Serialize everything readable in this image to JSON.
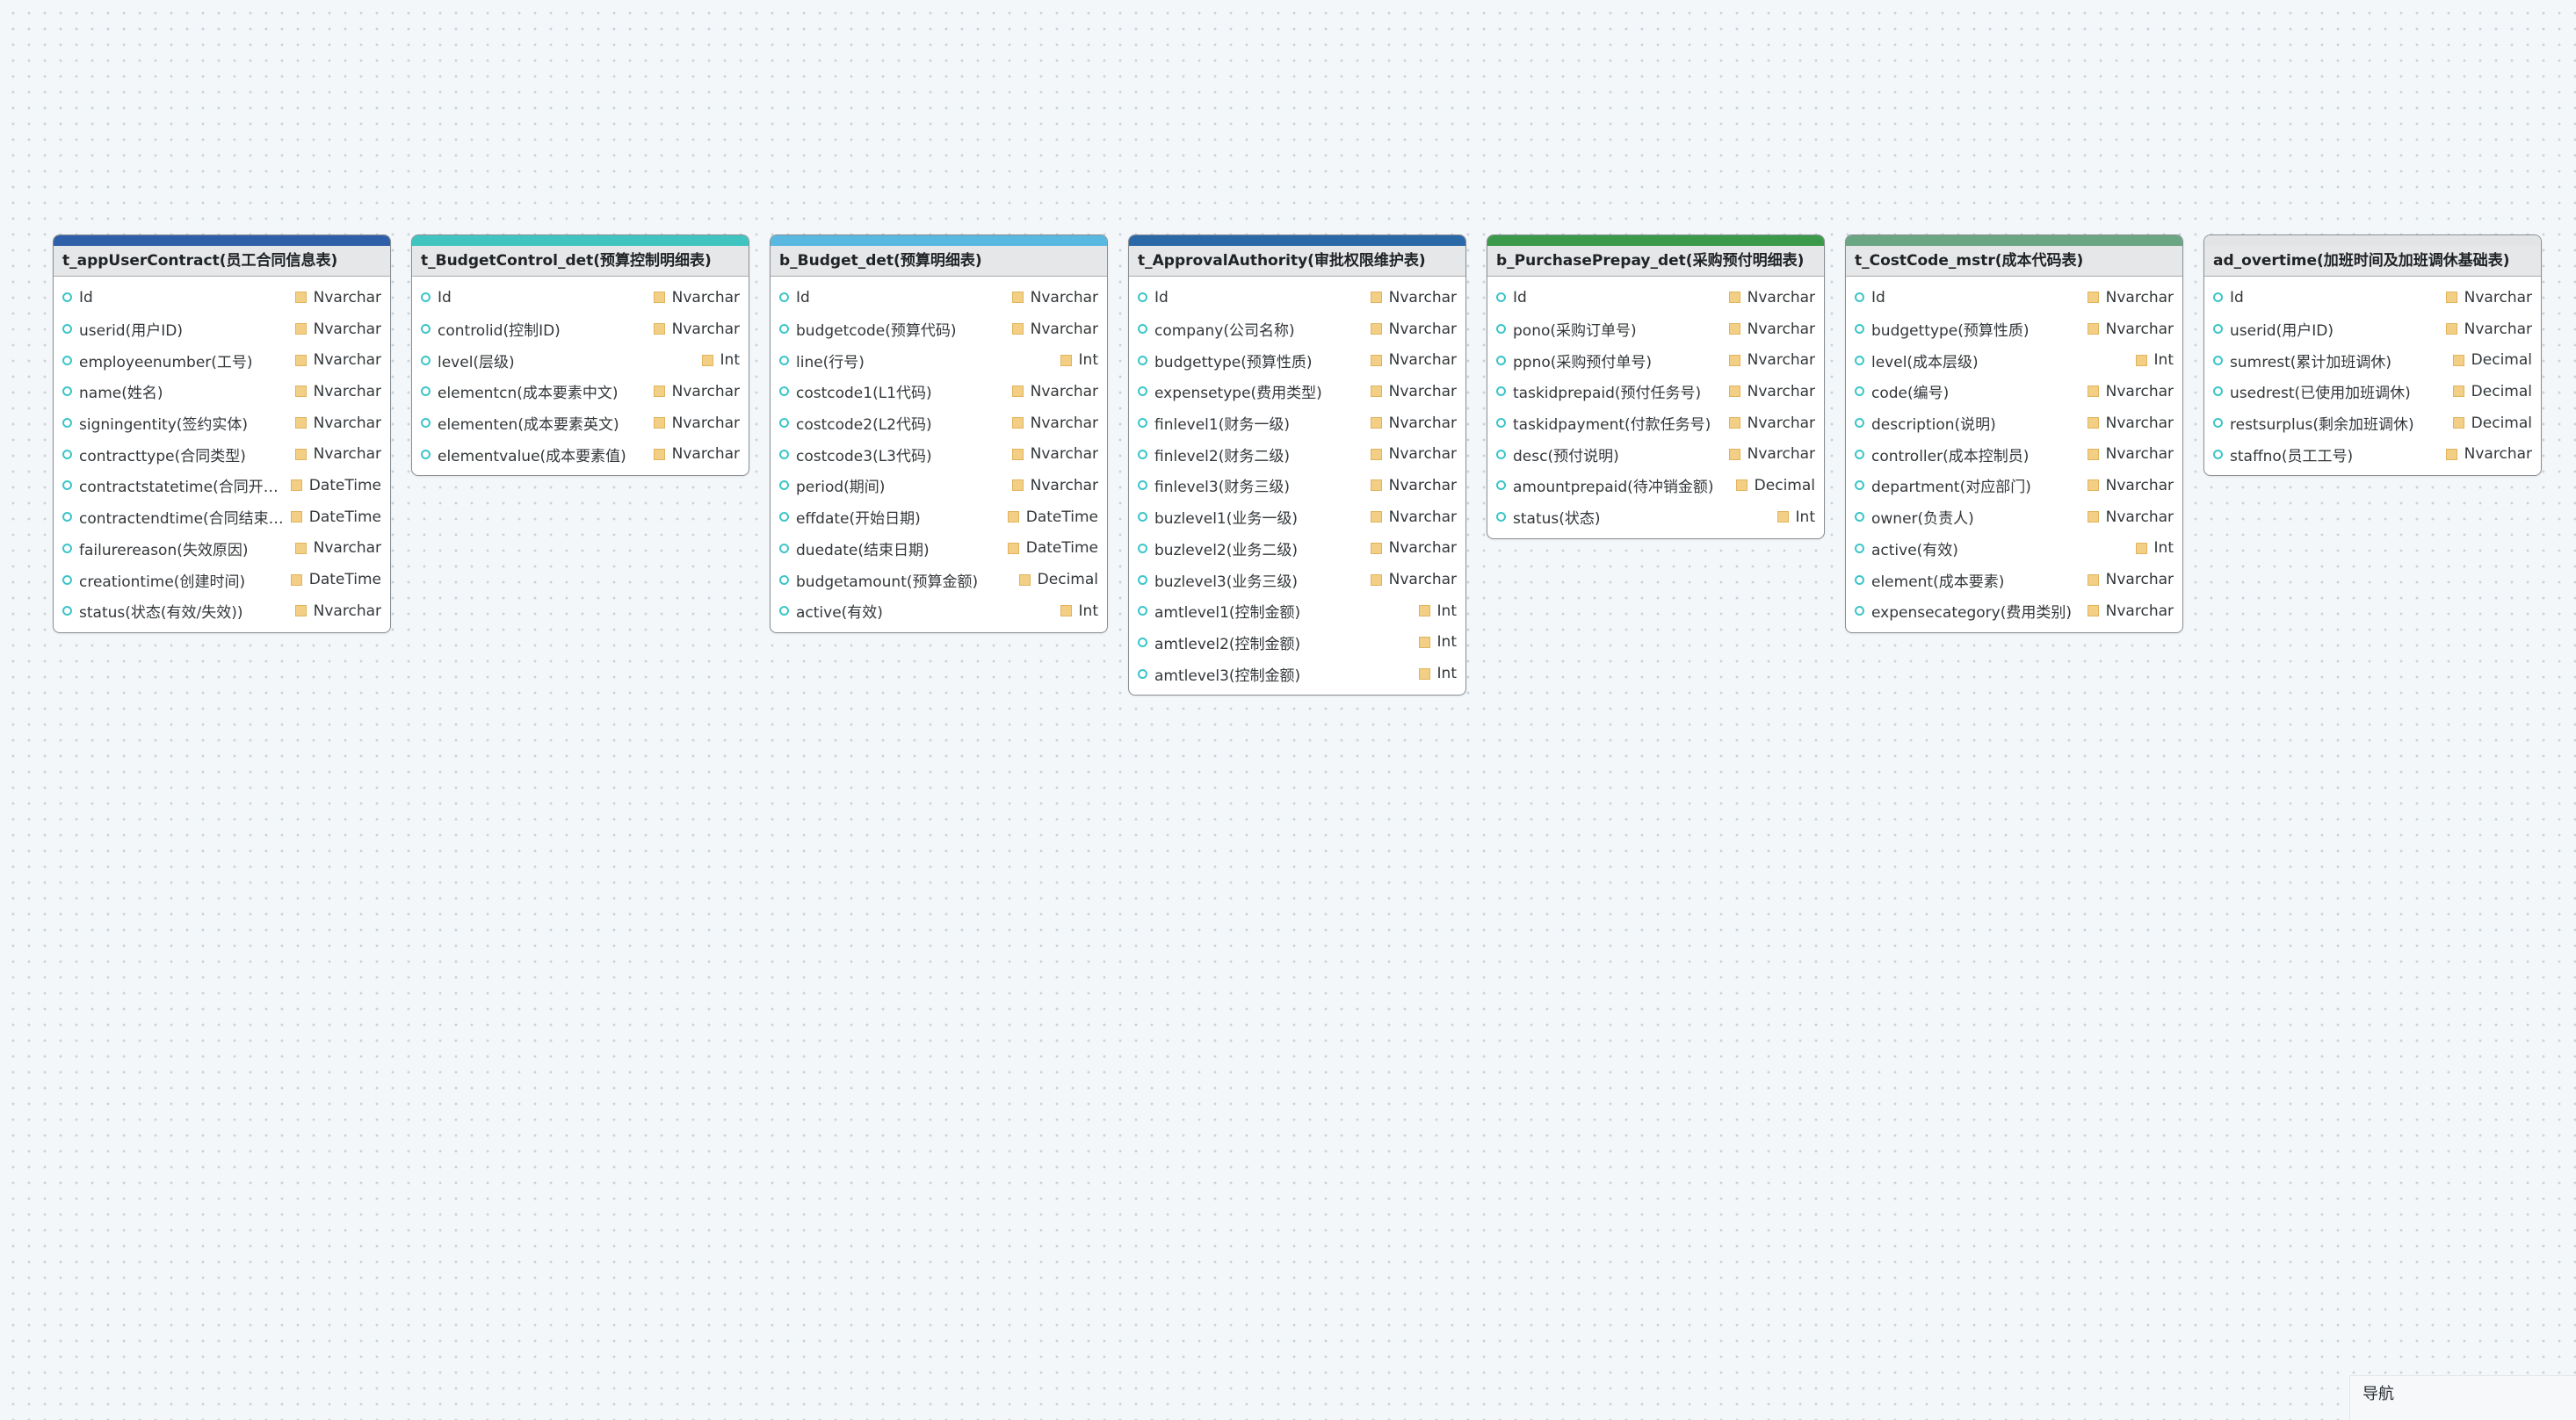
{
  "tables": [
    {
      "name": "t_appUserContract(员工合同信息表)",
      "color": "#2f5fa8",
      "fields": [
        {
          "name": "Id",
          "type": "Nvarchar"
        },
        {
          "name": "userid(用户ID)",
          "type": "Nvarchar"
        },
        {
          "name": "employeenumber(工号)",
          "type": "Nvarchar"
        },
        {
          "name": "name(姓名)",
          "type": "Nvarchar"
        },
        {
          "name": "signingentity(签约实体)",
          "type": "Nvarchar"
        },
        {
          "name": "contracttype(合同类型)",
          "type": "Nvarchar"
        },
        {
          "name": "contractstatetime(合同开始时...",
          "type": "DateTime"
        },
        {
          "name": "contractendtime(合同结束时间)",
          "type": "DateTime"
        },
        {
          "name": "failurereason(失效原因)",
          "type": "Nvarchar"
        },
        {
          "name": "creationtime(创建时间)",
          "type": "DateTime"
        },
        {
          "name": "status(状态(有效/失效))",
          "type": "Nvarchar"
        }
      ]
    },
    {
      "name": "t_BudgetControl_det(预算控制明细表)",
      "color": "#3fc4c0",
      "fields": [
        {
          "name": "Id",
          "type": "Nvarchar"
        },
        {
          "name": "controlid(控制ID)",
          "type": "Nvarchar"
        },
        {
          "name": "level(层级)",
          "type": "Int"
        },
        {
          "name": "elementcn(成本要素中文)",
          "type": "Nvarchar"
        },
        {
          "name": "elementen(成本要素英文)",
          "type": "Nvarchar"
        },
        {
          "name": "elementvalue(成本要素值)",
          "type": "Nvarchar"
        }
      ]
    },
    {
      "name": "b_Budget_det(预算明细表)",
      "color": "#58b8e0",
      "fields": [
        {
          "name": "Id",
          "type": "Nvarchar"
        },
        {
          "name": "budgetcode(预算代码)",
          "type": "Nvarchar"
        },
        {
          "name": "line(行号)",
          "type": "Int"
        },
        {
          "name": "costcode1(L1代码)",
          "type": "Nvarchar"
        },
        {
          "name": "costcode2(L2代码)",
          "type": "Nvarchar"
        },
        {
          "name": "costcode3(L3代码)",
          "type": "Nvarchar"
        },
        {
          "name": "period(期间)",
          "type": "Nvarchar"
        },
        {
          "name": "effdate(开始日期)",
          "type": "DateTime"
        },
        {
          "name": "duedate(结束日期)",
          "type": "DateTime"
        },
        {
          "name": "budgetamount(预算金额)",
          "type": "Decimal"
        },
        {
          "name": "active(有效)",
          "type": "Int"
        }
      ]
    },
    {
      "name": "t_ApprovalAuthority(审批权限维护表)",
      "color": "#2a68a8",
      "fields": [
        {
          "name": "Id",
          "type": "Nvarchar"
        },
        {
          "name": "company(公司名称)",
          "type": "Nvarchar"
        },
        {
          "name": "budgettype(预算性质)",
          "type": "Nvarchar"
        },
        {
          "name": "expensetype(费用类型)",
          "type": "Nvarchar"
        },
        {
          "name": "finlevel1(财务一级)",
          "type": "Nvarchar"
        },
        {
          "name": "finlevel2(财务二级)",
          "type": "Nvarchar"
        },
        {
          "name": "finlevel3(财务三级)",
          "type": "Nvarchar"
        },
        {
          "name": "buzlevel1(业务一级)",
          "type": "Nvarchar"
        },
        {
          "name": "buzlevel2(业务二级)",
          "type": "Nvarchar"
        },
        {
          "name": "buzlevel3(业务三级)",
          "type": "Nvarchar"
        },
        {
          "name": "amtlevel1(控制金额)",
          "type": "Int"
        },
        {
          "name": "amtlevel2(控制金额)",
          "type": "Int"
        },
        {
          "name": "amtlevel3(控制金额)",
          "type": "Int"
        }
      ]
    },
    {
      "name": "b_PurchasePrepay_det(采购预付明细表)",
      "color": "#3a9a4a",
      "fields": [
        {
          "name": "Id",
          "type": "Nvarchar"
        },
        {
          "name": "pono(采购订单号)",
          "type": "Nvarchar"
        },
        {
          "name": "ppno(采购预付单号)",
          "type": "Nvarchar"
        },
        {
          "name": "taskidprepaid(预付任务号)",
          "type": "Nvarchar"
        },
        {
          "name": "taskidpayment(付款任务号)",
          "type": "Nvarchar"
        },
        {
          "name": "desc(预付说明)",
          "type": "Nvarchar"
        },
        {
          "name": "amountprepaid(待冲销金额)",
          "type": "Decimal"
        },
        {
          "name": "status(状态)",
          "type": "Int"
        }
      ]
    },
    {
      "name": "t_CostCode_mstr(成本代码表)",
      "color": "#6aa584",
      "fields": [
        {
          "name": "Id",
          "type": "Nvarchar"
        },
        {
          "name": "budgettype(预算性质)",
          "type": "Nvarchar"
        },
        {
          "name": "level(成本层级)",
          "type": "Int"
        },
        {
          "name": "code(编号)",
          "type": "Nvarchar"
        },
        {
          "name": "description(说明)",
          "type": "Nvarchar"
        },
        {
          "name": "controller(成本控制员)",
          "type": "Nvarchar"
        },
        {
          "name": "department(对应部门)",
          "type": "Nvarchar"
        },
        {
          "name": "owner(负责人)",
          "type": "Nvarchar"
        },
        {
          "name": "active(有效)",
          "type": "Int"
        },
        {
          "name": "element(成本要素)",
          "type": "Nvarchar"
        },
        {
          "name": "expensecategory(费用类别)",
          "type": "Nvarchar"
        }
      ]
    },
    {
      "name": "ad_overtime(加班时间及加班调休基础表)",
      "color": "#e3e4e6",
      "fields": [
        {
          "name": "Id",
          "type": "Nvarchar"
        },
        {
          "name": "userid(用户ID)",
          "type": "Nvarchar"
        },
        {
          "name": "sumrest(累计加班调休)",
          "type": "Decimal"
        },
        {
          "name": "usedrest(已使用加班调休)",
          "type": "Decimal"
        },
        {
          "name": "restsurplus(剩余加班调休)",
          "type": "Decimal"
        },
        {
          "name": "staffno(员工工号)",
          "type": "Nvarchar"
        }
      ]
    }
  ],
  "navigator": {
    "label": "导航"
  }
}
